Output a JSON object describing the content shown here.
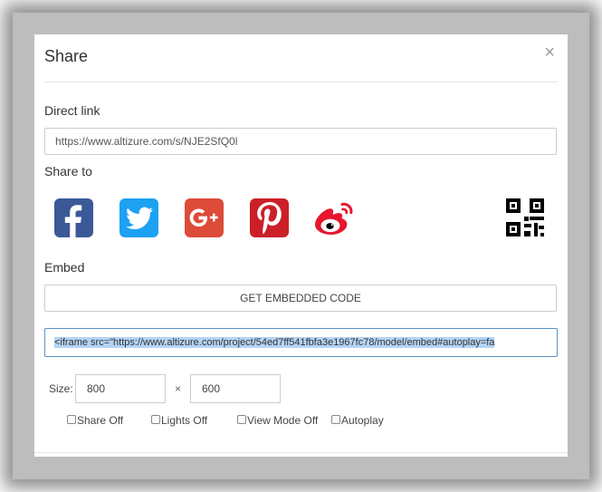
{
  "modal": {
    "title": "Share",
    "close_glyph": "×"
  },
  "direct_link": {
    "label": "Direct link",
    "url": "https://www.altizure.com/s/NJE2SfQ0l"
  },
  "share_to": {
    "label": "Share to",
    "icons": [
      {
        "name": "facebook-icon",
        "color": "#3b5998"
      },
      {
        "name": "twitter-icon",
        "color": "#1da1f2"
      },
      {
        "name": "google-plus-icon",
        "color": "#dd4b39"
      },
      {
        "name": "pinterest-icon",
        "color": "#cb2027"
      },
      {
        "name": "weibo-icon",
        "color": "#e6162d"
      },
      {
        "name": "qr-code-icon",
        "color": "#000000"
      }
    ]
  },
  "embed": {
    "label": "Embed",
    "button_label": "GET EMBEDDED CODE",
    "code": "<iframe src=\"https://www.altizure.com/project/54ed7ff541fbfa3e1967fc78/model/embed#autoplay=fa"
  },
  "size": {
    "label": "Size:",
    "width": "800",
    "separator": "×",
    "height": "600"
  },
  "options": [
    {
      "label": "Share Off",
      "checked": false
    },
    {
      "label": "Lights Off",
      "checked": false
    },
    {
      "label": "View Mode Off",
      "checked": false
    },
    {
      "label": "Autoplay",
      "checked": false
    }
  ]
}
